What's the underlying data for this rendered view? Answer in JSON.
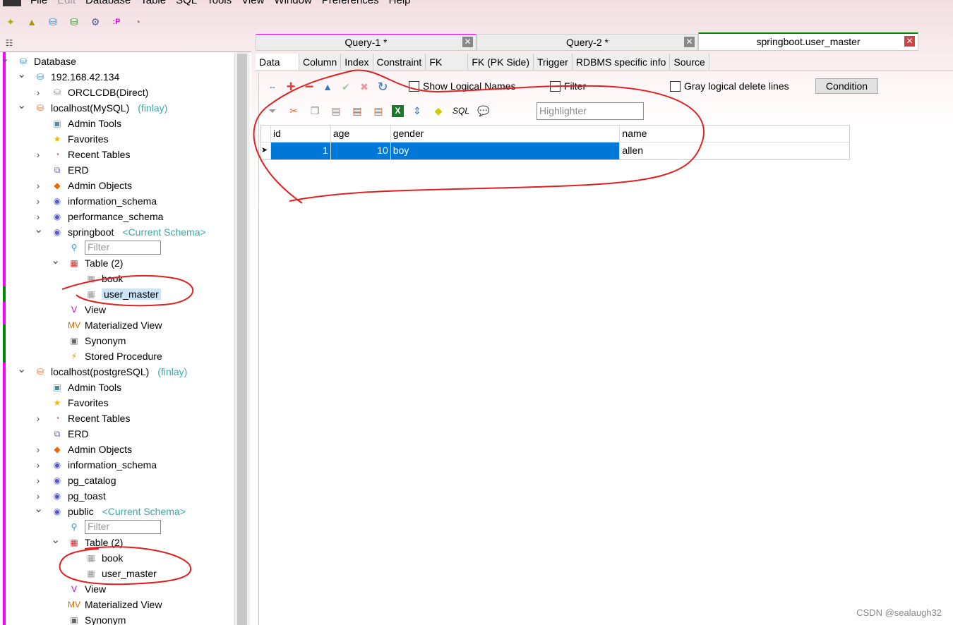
{
  "menu": [
    "File",
    "Edit",
    "Database",
    "Table",
    "SQL",
    "Tools",
    "View",
    "Window",
    "Preferences",
    "Help"
  ],
  "tabs": [
    {
      "label": "Query-1 *"
    },
    {
      "label": "Query-2 *"
    },
    {
      "label": "springboot.user_master",
      "active": true
    }
  ],
  "subtabs": [
    "Data",
    "Column",
    "Index",
    "Constraint",
    "FK",
    "FK (PK Side)",
    "Trigger",
    "RDBMS specific info",
    "Source"
  ],
  "options": {
    "show_logical_names": "Show Logical Names",
    "filter": "Filter",
    "gray_logical": "Gray logical delete lines",
    "condition": "Condition",
    "highlighter_placeholder": "Highlighter",
    "sql_label": "SQL"
  },
  "grid": {
    "columns": [
      "id",
      "age",
      "gender",
      "name"
    ],
    "rows": [
      [
        "1",
        "10",
        "boy",
        "allen"
      ]
    ]
  },
  "tree": [
    {
      "l": 0,
      "e": "open",
      "t": "Database",
      "i": "database-icon"
    },
    {
      "l": 1,
      "e": "open",
      "t": "192.168.42.134",
      "i": "database-icon"
    },
    {
      "l": 2,
      "e": "closed",
      "t": "ORCLCDB(Direct)",
      "i": "db-cylinder-icon"
    },
    {
      "l": 1,
      "e": "open",
      "t": "localhost(MySQL)",
      "s": "(finlay)",
      "i": "mysql-connection-icon"
    },
    {
      "l": 2,
      "t": "Admin Tools",
      "i": "admin-tools-icon"
    },
    {
      "l": 2,
      "t": "Favorites",
      "i": "star-icon"
    },
    {
      "l": 2,
      "e": "closed",
      "t": "Recent Tables",
      "i": "clock-icon"
    },
    {
      "l": 2,
      "t": "ERD",
      "i": "erd-icon"
    },
    {
      "l": 2,
      "e": "closed",
      "t": "Admin Objects",
      "i": "shapes-icon"
    },
    {
      "l": 2,
      "e": "closed",
      "t": "information_schema",
      "i": "schema-icon"
    },
    {
      "l": 2,
      "e": "closed",
      "t": "performance_schema",
      "i": "schema-icon"
    },
    {
      "l": 2,
      "e": "open",
      "t": "springboot",
      "s": "<Current Schema>",
      "i": "schema-icon"
    },
    {
      "l": 3,
      "f": true,
      "t": "Filter",
      "i": "search-icon"
    },
    {
      "l": 3,
      "e": "open",
      "t": "Table (2)",
      "i": "table-folder-icon"
    },
    {
      "l": 4,
      "t": "book",
      "i": "table-icon"
    },
    {
      "l": 4,
      "t": "user_master",
      "i": "table-icon",
      "sel": true
    },
    {
      "l": 3,
      "t": "View",
      "i": "view-icon"
    },
    {
      "l": 3,
      "t": "Materialized View",
      "i": "mview-icon"
    },
    {
      "l": 3,
      "t": "Synonym",
      "i": "synonym-icon"
    },
    {
      "l": 3,
      "t": "Stored Procedure",
      "i": "lightning-icon"
    },
    {
      "l": 1,
      "e": "open",
      "t": "localhost(postgreSQL)",
      "s": "(finlay)",
      "i": "postgres-connection-icon"
    },
    {
      "l": 2,
      "t": "Admin Tools",
      "i": "admin-tools-icon"
    },
    {
      "l": 2,
      "t": "Favorites",
      "i": "star-icon"
    },
    {
      "l": 2,
      "e": "closed",
      "t": "Recent Tables",
      "i": "clock-icon"
    },
    {
      "l": 2,
      "t": "ERD",
      "i": "erd-icon"
    },
    {
      "l": 2,
      "e": "closed",
      "t": "Admin Objects",
      "i": "shapes-icon"
    },
    {
      "l": 2,
      "e": "closed",
      "t": "information_schema",
      "i": "schema-icon"
    },
    {
      "l": 2,
      "e": "closed",
      "t": "pg_catalog",
      "i": "schema-icon"
    },
    {
      "l": 2,
      "e": "closed",
      "t": "pg_toast",
      "i": "schema-icon"
    },
    {
      "l": 2,
      "e": "open",
      "t": "public",
      "s": "<Current Schema>",
      "i": "schema-icon"
    },
    {
      "l": 3,
      "f": true,
      "t": "Filter",
      "i": "search-icon"
    },
    {
      "l": 3,
      "e": "open",
      "t": "Table (2)",
      "i": "table-folder-icon"
    },
    {
      "l": 4,
      "t": "book",
      "i": "table-icon"
    },
    {
      "l": 4,
      "t": "user_master",
      "i": "table-icon"
    },
    {
      "l": 3,
      "t": "View",
      "i": "view-icon"
    },
    {
      "l": 3,
      "t": "Materialized View",
      "i": "mview-icon"
    },
    {
      "l": 3,
      "t": "Synonym",
      "i": "synonym-icon"
    }
  ],
  "watermark": "CSDN @sealaugh32"
}
